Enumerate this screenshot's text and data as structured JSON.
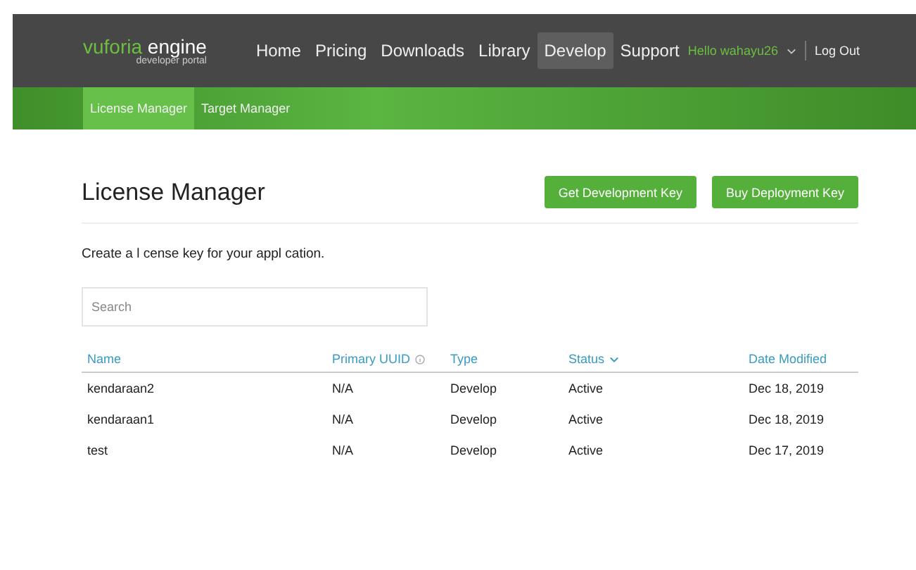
{
  "header": {
    "logo": {
      "brand": "vuforia",
      "product": "engine",
      "tagline": "developer portal"
    },
    "nav": [
      {
        "label": "Home",
        "selected": false
      },
      {
        "label": "Pricing",
        "selected": false
      },
      {
        "label": "Downloads",
        "selected": false
      },
      {
        "label": "Library",
        "selected": false
      },
      {
        "label": "Develop",
        "selected": true
      },
      {
        "label": "Support",
        "selected": false
      }
    ],
    "user": "Hello wahayu26",
    "logout": "Log Out"
  },
  "subnav": [
    {
      "label": "License Manager",
      "selected": true
    },
    {
      "label": "Target Manager",
      "selected": false
    }
  ],
  "page": {
    "title": "License Manager",
    "buttons": [
      "Get Development Key",
      "Buy Deployment Key"
    ],
    "description": "Create a l cense key for your appl cation.",
    "search": {
      "placeholder": "Search"
    }
  },
  "table": {
    "columns": [
      {
        "label": "Name",
        "kind": "plain"
      },
      {
        "label": "Primary UUID",
        "kind": "info"
      },
      {
        "label": "Type",
        "kind": "plain"
      },
      {
        "label": "Status",
        "kind": "sorted"
      },
      {
        "label": "Date Modified",
        "kind": "plain"
      }
    ],
    "rows": [
      [
        "kendaraan2",
        "N/A",
        "Develop",
        "Active",
        "Dec 18, 2019"
      ],
      [
        "kendaraan1",
        "N/A",
        "Develop",
        "Active",
        "Dec 18, 2019"
      ],
      [
        "test",
        "N/A",
        "Develop",
        "Active",
        "Dec 17, 2019"
      ]
    ]
  }
}
